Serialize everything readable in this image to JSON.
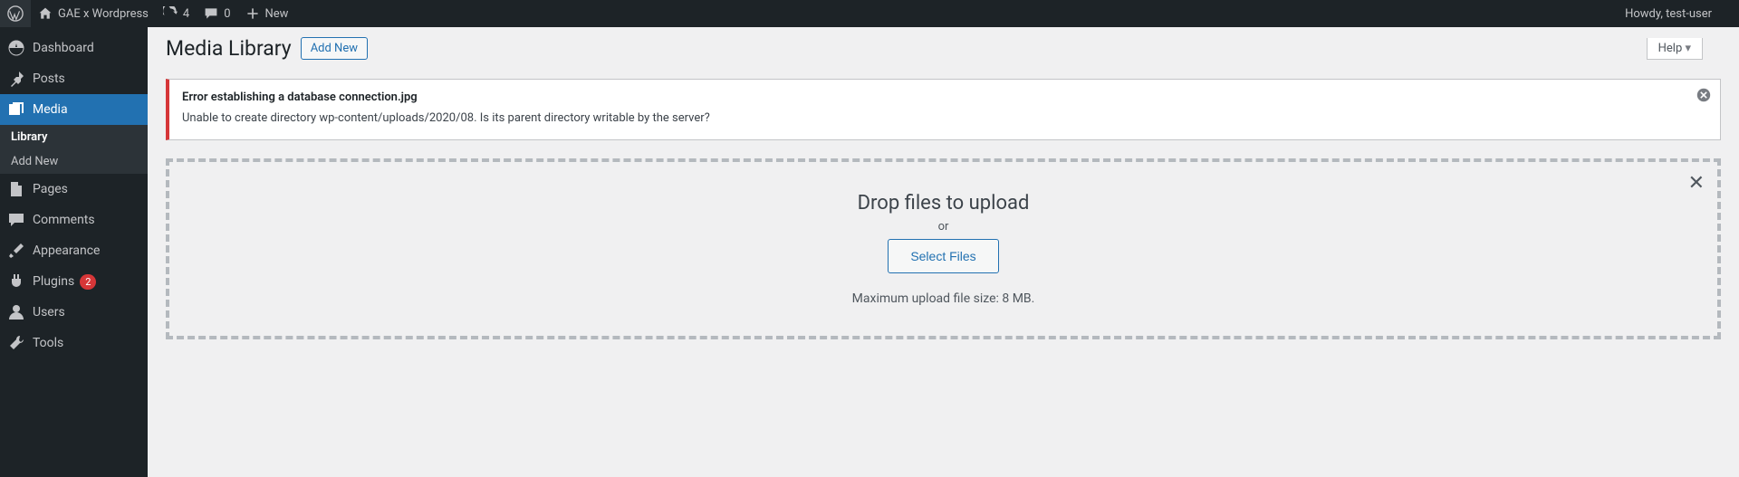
{
  "adminbar": {
    "site": "GAE x Wordpress",
    "updates": "4",
    "comments": "0",
    "new": "New",
    "howdy": "Howdy, test-user"
  },
  "menu": {
    "dashboard": "Dashboard",
    "posts": "Posts",
    "media": "Media",
    "media_sub": {
      "library": "Library",
      "add_new": "Add New"
    },
    "pages": "Pages",
    "comments": "Comments",
    "appearance": "Appearance",
    "plugins": "Plugins",
    "plugins_badge": "2",
    "users": "Users",
    "tools": "Tools"
  },
  "header": {
    "title": "Media Library",
    "add_new": "Add New",
    "help": "Help"
  },
  "notice": {
    "title": "Error establishing a database connection.jpg",
    "message": "Unable to create directory wp-content/uploads/2020/08. Is its parent directory writable by the server?"
  },
  "uploader": {
    "drop": "Drop files to upload",
    "or": "or",
    "select": "Select Files",
    "maxsize": "Maximum upload file size: 8 MB."
  }
}
